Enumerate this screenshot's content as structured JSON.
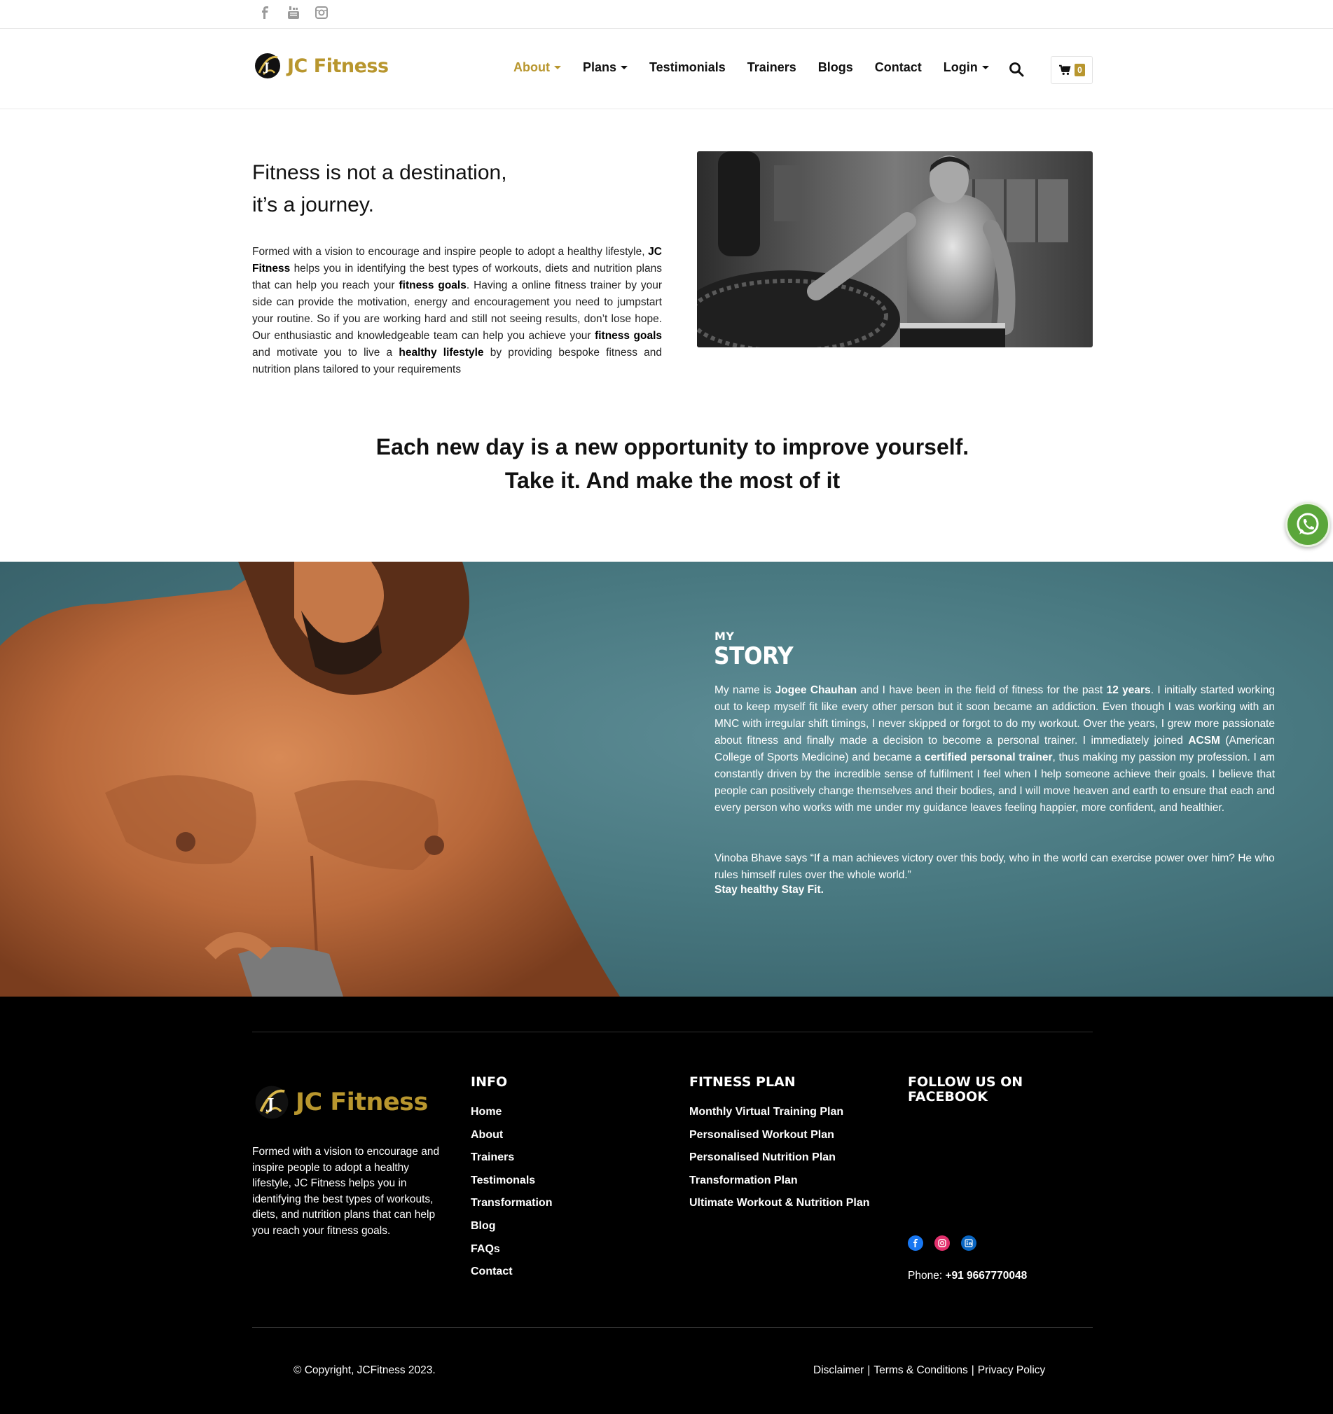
{
  "topbar": {
    "icons": [
      "facebook-icon",
      "youtube-icon",
      "instagram-icon"
    ]
  },
  "brand": {
    "name": "JC Fitness",
    "color": "#b8962e"
  },
  "nav": {
    "items": [
      {
        "label": "About",
        "dropdown": true,
        "active": true
      },
      {
        "label": "Plans",
        "dropdown": true,
        "active": false
      },
      {
        "label": "Testimonials",
        "dropdown": false,
        "active": false
      },
      {
        "label": "Trainers",
        "dropdown": false,
        "active": false
      },
      {
        "label": "Blogs",
        "dropdown": false,
        "active": false
      },
      {
        "label": "Contact",
        "dropdown": false,
        "active": false
      },
      {
        "label": "Login",
        "dropdown": true,
        "active": false
      }
    ],
    "cart_count": "0"
  },
  "intro": {
    "title_line1": "Fitness is not a destination,",
    "title_line2": "it’s a journey.",
    "p1": "Formed with a vision to encourage and inspire people to adopt a healthy lifestyle, ",
    "b1": "JC Fitness",
    "p2": " helps you in identifying the best types of workouts, diets and nutrition plans that can help you reach your ",
    "b2": "fitness goals",
    "p3": ". Having a online fitness trainer by your side can provide the motivation, energy and encouragement you need to jumpstart your routine. So if you are working hard and still not seeing results, don’t lose hope. Our enthusiastic and knowledgeable team can help you achieve your ",
    "b3": "fitness goals",
    "p4": " and motivate you to live a ",
    "b4": "healthy lifestyle",
    "p5": " by providing bespoke fitness and nutrition plans tailored to your requirements"
  },
  "quote": {
    "line1": "Each new day is a new opportunity to improve yourself.",
    "line2": "Take it. And make the most of it"
  },
  "story": {
    "kicker": "MY",
    "title": "STORY",
    "s1": "My name is ",
    "b1": "Jogee Chauhan",
    "s2": " and I have been in the field of fitness for the past ",
    "b2": "12 years",
    "s3": ". I initially started working out to keep myself fit like every other person but it soon became an addiction. Even though I was working with an MNC with irregular shift timings, I never skipped or forgot to do my workout. Over the years, I grew more passionate about fitness and finally made a decision to become a personal trainer. I immediately joined ",
    "b3": "ACSM",
    "s4": " (American College of Sports Medicine) and became a ",
    "b4": "certified personal trainer",
    "s5": ", thus making my passion my profession. I am constantly driven by the incredible sense of fulfilment I feel when I help someone achieve their goals. I believe that people can positively change themselves and their bodies, and I will move heaven and earth to ensure that each and every person who works with me under my guidance leaves feeling happier, more confident, and healthier.",
    "quote": "Vinoba Bhave says “If a man achieves victory over this body, who in the world can exercise power over him? He who rules himself  rules over the whole world.”",
    "sign": "Stay healthy Stay Fit."
  },
  "footer": {
    "brand": "JC Fitness",
    "description": "Formed with a vision to encourage and inspire people to adopt a healthy lifestyle, JC Fitness helps you in identifying the best types of workouts, diets, and nutrition plans that can help you reach your fitness goals.",
    "info_title": "INFO",
    "info_links": [
      "Home",
      "About",
      "Trainers",
      "Testimonals",
      "Transformation",
      "Blog",
      "FAQs",
      "Contact"
    ],
    "plan_title": "FITNESS PLAN",
    "plan_links": [
      "Monthly Virtual Training Plan",
      "Personalised Workout Plan",
      "Personalised Nutrition Plan",
      "Transformation Plan",
      "Ultimate Workout & Nutrition Plan"
    ],
    "follow_title_line1": "FOLLOW US ON",
    "follow_title_line2": "FACEBOOK",
    "social_icons": [
      "facebook-icon",
      "instagram-icon",
      "linkedin-icon"
    ],
    "phone_label": "Phone: ",
    "phone_number": "+91 9667770048",
    "copyright": "© Copyright, JCFitness 2023.",
    "legal": {
      "disclaimer": "Disclaimer",
      "sep": "|",
      "terms": "Terms & Conditions",
      "privacy": "Privacy Policy"
    }
  }
}
